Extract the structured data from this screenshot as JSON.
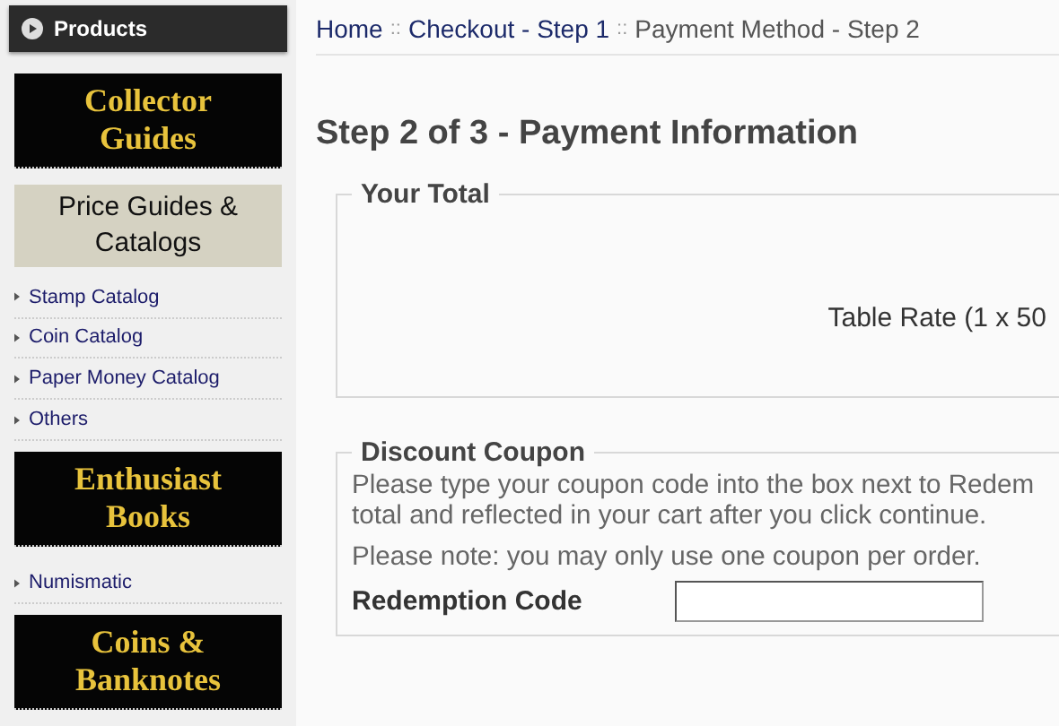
{
  "sidebar": {
    "header": "Products",
    "blocks": [
      {
        "kind": "banner",
        "label": "Collector Guides"
      },
      {
        "kind": "header",
        "label": "Price Guides & Catalogs"
      },
      {
        "kind": "link",
        "label": "Stamp Catalog"
      },
      {
        "kind": "link",
        "label": "Coin Catalog"
      },
      {
        "kind": "link",
        "label": "Paper Money Catalog"
      },
      {
        "kind": "link",
        "label": "Others"
      },
      {
        "kind": "banner",
        "label": "Enthusiast Books"
      },
      {
        "kind": "link",
        "label": "Numismatic"
      },
      {
        "kind": "banner",
        "label": "Coins & Banknotes"
      }
    ]
  },
  "breadcrumb": [
    {
      "kind": "link",
      "text": "Home"
    },
    {
      "kind": "sep",
      "text": "::"
    },
    {
      "kind": "link",
      "text": "Checkout - Step 1"
    },
    {
      "kind": "sep",
      "text": "::"
    },
    {
      "kind": "current",
      "text": "Payment Method - Step 2"
    }
  ],
  "title": "Step 2 of 3 - Payment Information",
  "total": {
    "legend": "Your Total",
    "line": "Table Rate (1 x 50"
  },
  "coupon": {
    "legend": "Discount Coupon",
    "lines": [
      "Please type your coupon code into the box next to Redem",
      "total and reflected in your cart after you click continue."
    ],
    "note": "Please note: you may only use one coupon per order.",
    "field_label": "Redemption Code"
  }
}
